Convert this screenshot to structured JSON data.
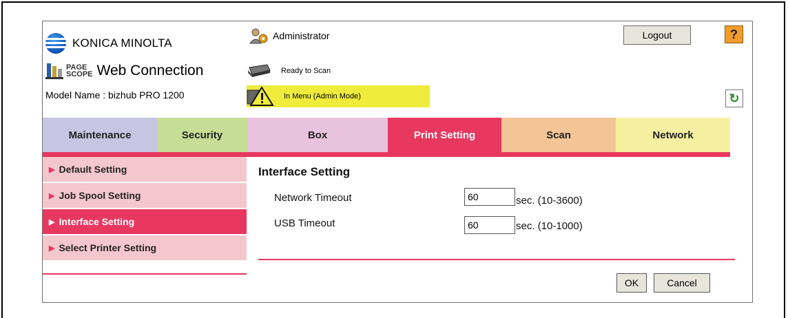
{
  "brand": {
    "company": "KONICA MINOLTA",
    "product_small_top": "PAGE",
    "product_small_bottom": "SCOPE",
    "product_name": "Web Connection",
    "model": "Model Name : bizhub PRO 1200"
  },
  "header": {
    "user": "Administrator",
    "status_ready": "Ready to Scan",
    "status_menu": "In Menu (Admin Mode)",
    "logout_label": "Logout",
    "help_label": "?"
  },
  "tabs": [
    {
      "label": "Maintenance",
      "color": "#c6c5e2"
    },
    {
      "label": "Security",
      "color": "#c5dd95"
    },
    {
      "label": "Box",
      "color": "#e9c3dd"
    },
    {
      "label": "Print Setting",
      "color": "#e8385f"
    },
    {
      "label": "Scan",
      "color": "#f3c496"
    },
    {
      "label": "Network",
      "color": "#f4f0a0"
    }
  ],
  "sidebar": {
    "items": [
      {
        "label": "Default Setting"
      },
      {
        "label": "Job Spool Setting"
      },
      {
        "label": "Interface Setting"
      },
      {
        "label": "Select Printer Setting"
      }
    ]
  },
  "main": {
    "title": "Interface Setting",
    "rows": [
      {
        "label": "Network Timeout",
        "value": "60",
        "unit": "sec. (10-3600)"
      },
      {
        "label": "USB Timeout",
        "value": "60",
        "unit": "sec. (10-1000)"
      }
    ],
    "ok_label": "OK",
    "cancel_label": "Cancel"
  },
  "colors": {
    "accent": "#e8385f",
    "warning_bg": "#f0ec3c",
    "sidebar_bg": "#f4c7cd"
  }
}
